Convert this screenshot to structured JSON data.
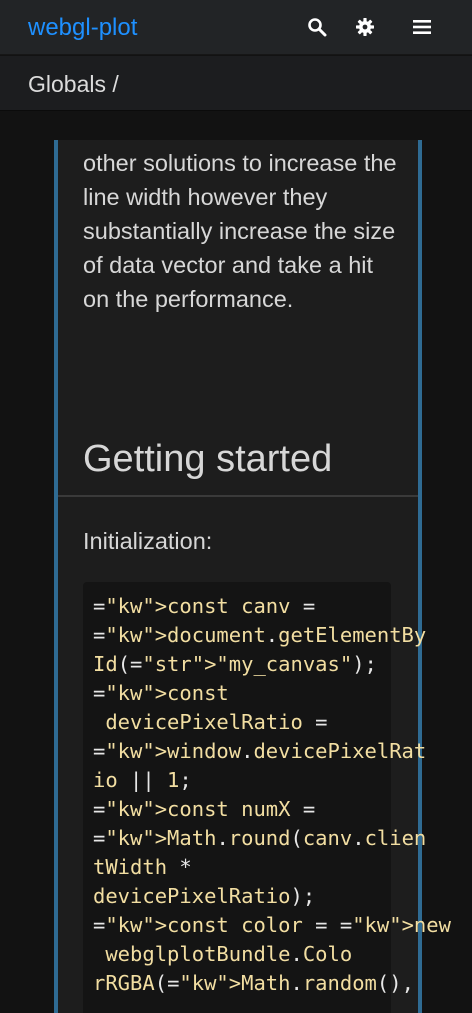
{
  "header": {
    "brand": "webgl-plot",
    "icons": [
      "search-icon",
      "gear-icon",
      "menu-icon"
    ]
  },
  "breadcrumb": {
    "text": "Globals /"
  },
  "main": {
    "paragraph": "other solutions to increase the line width however they substantially increase the size of data vector and take a hit on the performance.",
    "heading": "Getting started",
    "init_label": "Initialization:",
    "code_lines": [
      "const canv =",
      "document.getElementBy",
      "Id(\"my_canvas\");",
      "const",
      " devicePixelRatio =",
      "window.devicePixelRat",
      "io || 1;",
      "const numX =",
      "Math.round(canv.clien",
      "tWidth *",
      "devicePixelRatio);",
      "const color = new",
      " webglplotBundle.Colo",
      "rRGBA(Math.random(),"
    ]
  },
  "colors": {
    "brand": "#1e90ff",
    "accent_border": "#2f6b93",
    "keyword": "#569cd6",
    "string": "#d38b8b",
    "code_text": "#f2dea2"
  }
}
